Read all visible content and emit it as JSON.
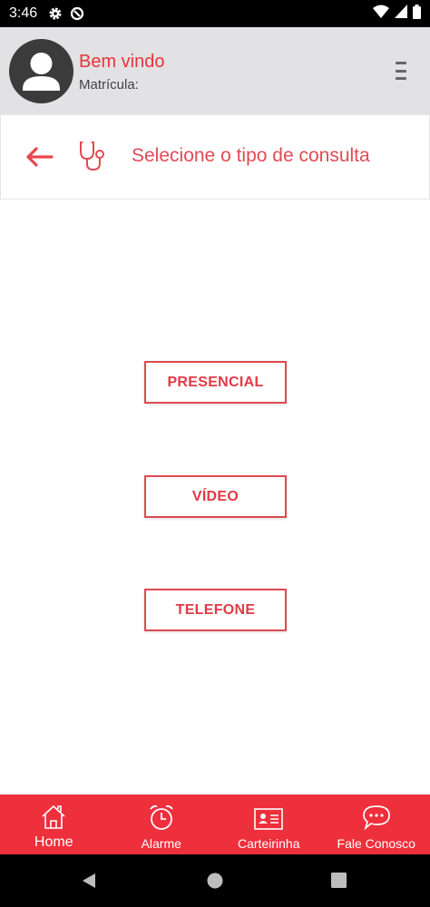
{
  "status_bar": {
    "time": "3:46"
  },
  "header": {
    "greeting": "Bem vindo",
    "matricula_label": "Matrícula:"
  },
  "title_bar": {
    "title": "Selecione o tipo de consulta"
  },
  "options": [
    {
      "label": "PRESENCIAL"
    },
    {
      "label": "VÍDEO"
    },
    {
      "label": "TELEFONE"
    }
  ],
  "bottom_nav": [
    {
      "label": "Home",
      "icon": "home-icon"
    },
    {
      "label": "Alarme",
      "icon": "alarm-clock-icon"
    },
    {
      "label": "Carteirinha",
      "icon": "id-card-icon"
    },
    {
      "label": "Fale Conosco",
      "icon": "chat-bubble-icon"
    }
  ],
  "colors": {
    "accent": "#ee2f3c",
    "header_bg": "#e2e1e3",
    "title_text": "#e14a55"
  }
}
